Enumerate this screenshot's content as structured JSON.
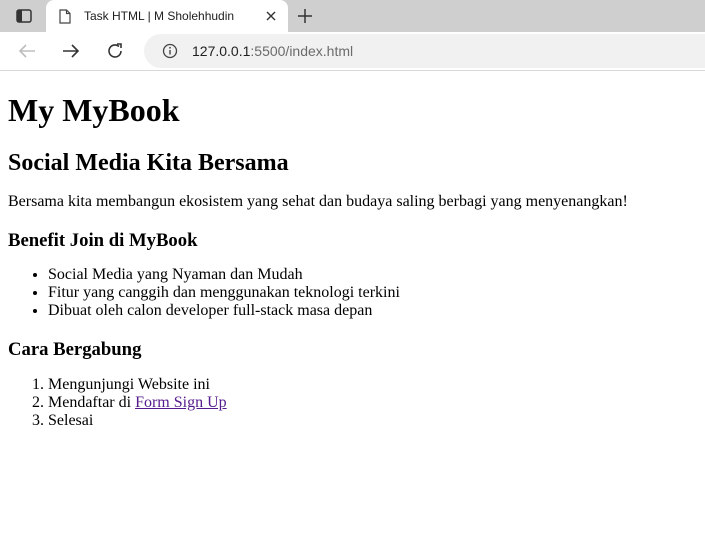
{
  "browser": {
    "tab_title": "Task HTML | M Sholehhudin",
    "url_host": "127.0.0.1",
    "url_path": ":5500/index.html",
    "icons": {
      "sidebar": "sidebar-toggle-icon",
      "favicon": "page-icon",
      "close": "close-icon",
      "new_tab": "plus-icon",
      "back": "back-arrow-icon",
      "forward": "forward-arrow-icon",
      "reload": "reload-icon",
      "site_info": "info-icon"
    }
  },
  "page": {
    "title": "My MyBook",
    "subtitle": "Social Media Kita Bersama",
    "intro": "Bersama kita membangun ekosistem yang sehat dan budaya saling berbagi yang menyenangkan!",
    "benefits_heading": "Benefit Join di MyBook",
    "benefits": [
      "Social Media yang Nyaman dan Mudah",
      "Fitur yang canggih dan menggunakan teknologi terkini",
      "Dibuat oleh calon developer full-stack masa depan"
    ],
    "join_heading": "Cara Bergabung",
    "steps": [
      {
        "text": "Mengunjungi Website ini"
      },
      {
        "text": "Mendaftar di ",
        "link": "Form Sign Up"
      },
      {
        "text": "Selesai"
      }
    ],
    "link_color": "#551a8b"
  }
}
